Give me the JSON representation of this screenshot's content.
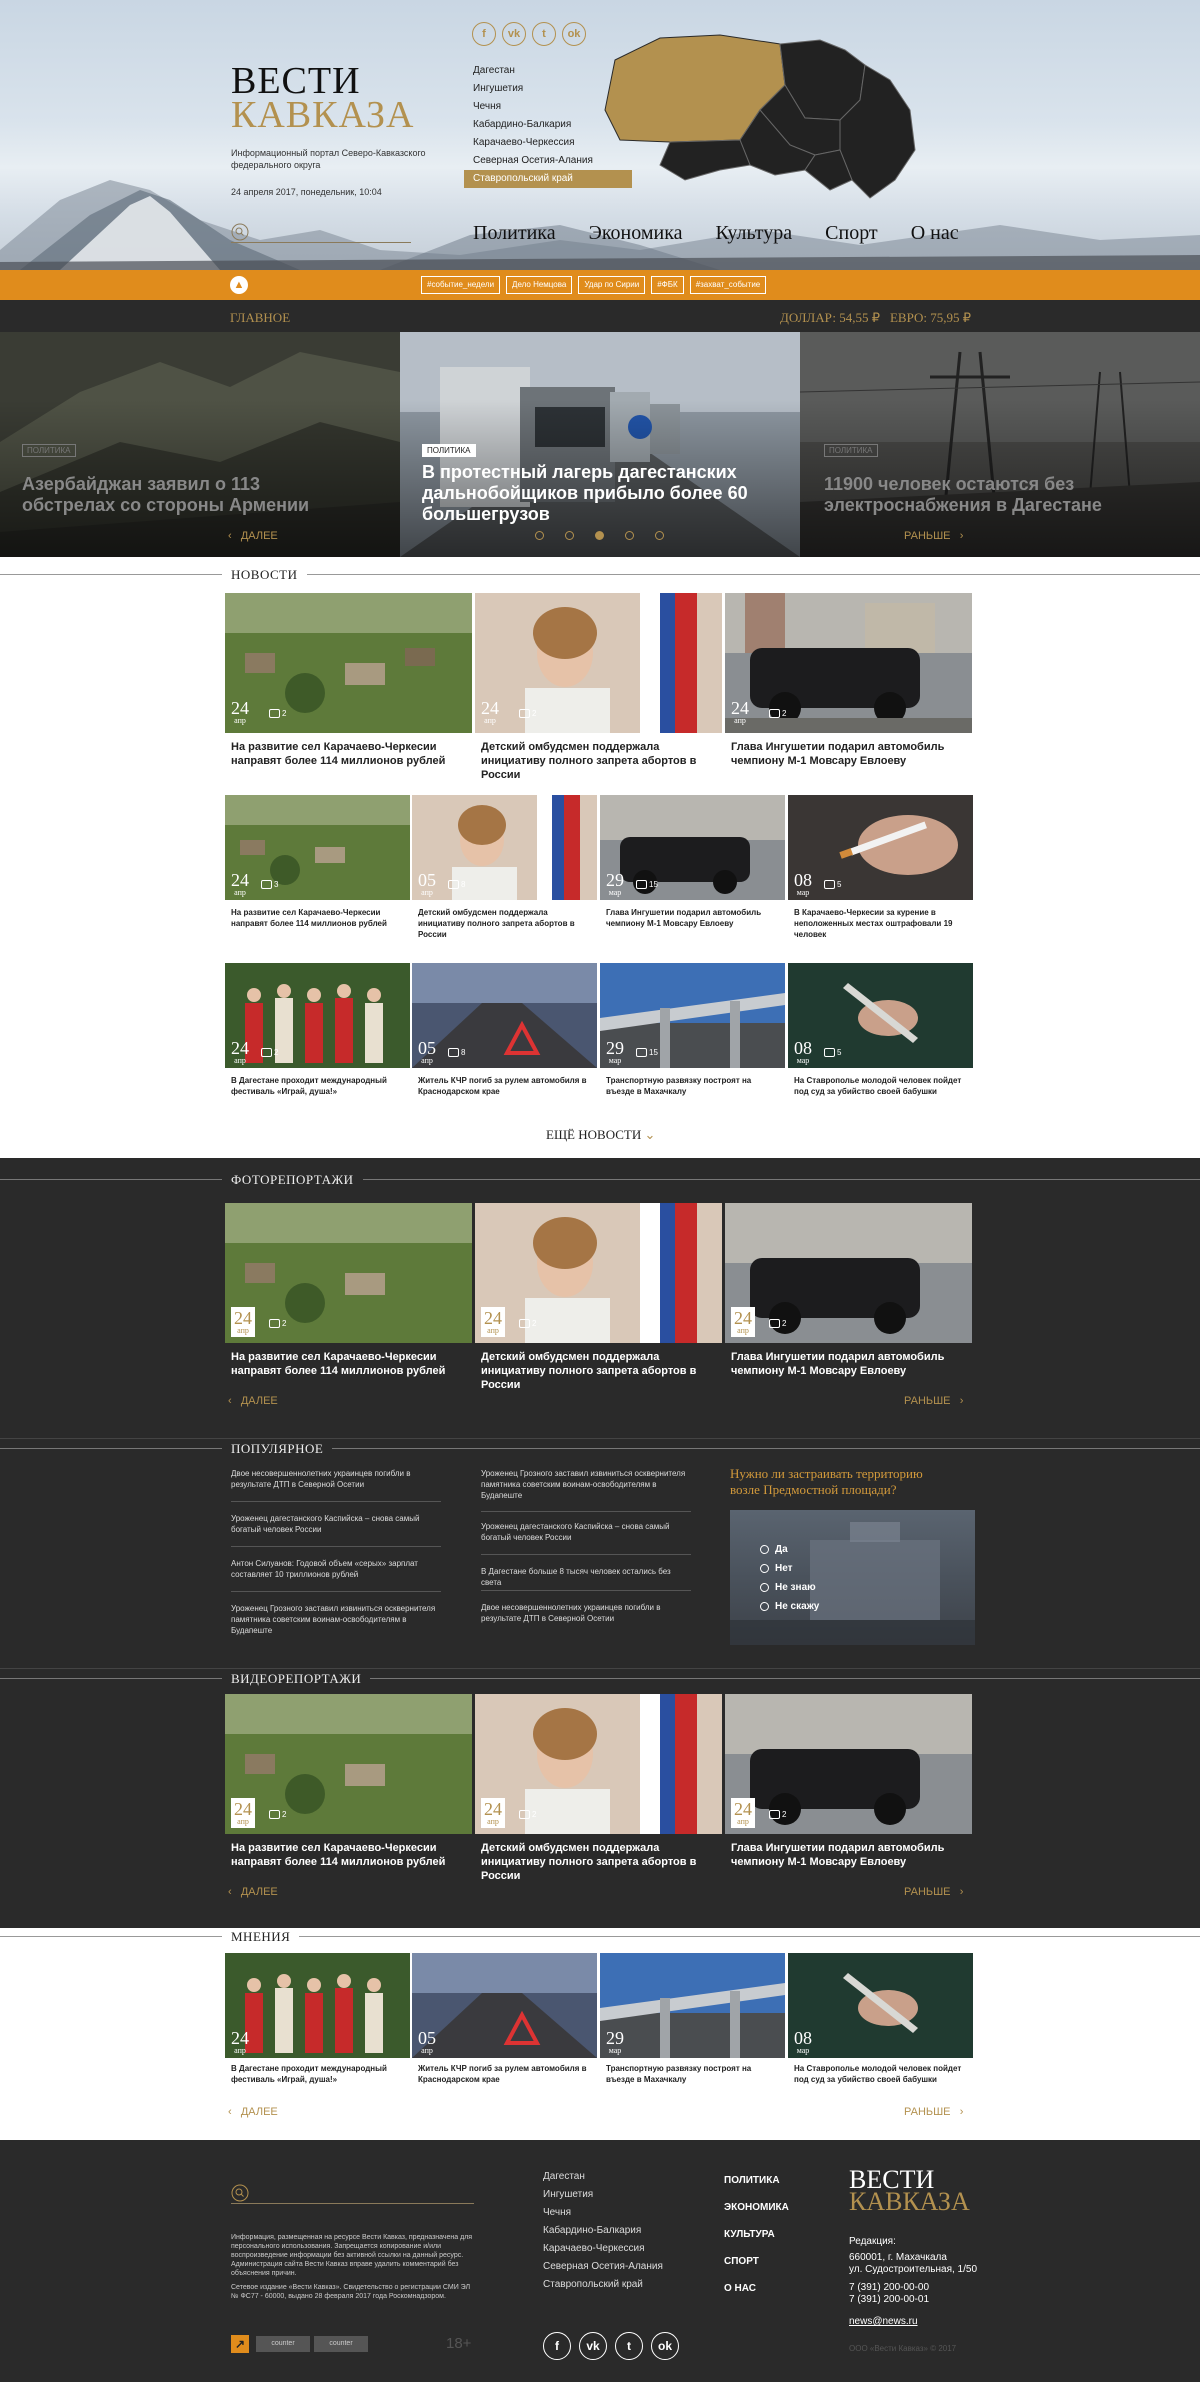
{
  "header": {
    "logo_line1": "ВЕСТИ",
    "logo_line2": "КАВКАЗА",
    "portal_desc": "Информационный портал Северо-Кавказского федерального округа",
    "date": "24 апреля 2017, понедельник, 10:04",
    "social_icons": [
      "facebook-icon",
      "vk-icon",
      "twitter-icon",
      "odnoklassniki-icon"
    ],
    "regions": [
      "Дагестан",
      "Ингушетия",
      "Чечня",
      "Кабардино-Балкария",
      "Карачаево-Черкессия",
      "Северная Осетия-Алания",
      "Ставропольский край"
    ],
    "active_region": "Ставропольский край",
    "nav": [
      "Политика",
      "Экономика",
      "Культура",
      "Спорт",
      "О нас"
    ]
  },
  "tagbar": {
    "tags": [
      "#событие_недели",
      "Дело Немцова",
      "Удар по Сирии",
      "#ФБК",
      "#захват_событие"
    ]
  },
  "topbar": {
    "label": "ГЛАВНОЕ",
    "dollar": "ДОЛЛАР: 54,55 ₽",
    "euro": "ЕВРО: 75,95 ₽"
  },
  "slider": {
    "slides": [
      {
        "label": "ПОЛИТИКА",
        "title": "Азербайджан заявил о 113 обстрелах со стороны Армении"
      },
      {
        "label": "ПОЛИТИКА",
        "title": "В протестный лагерь дагестанских дальнобойщиков прибыло более 60 большегрузов"
      },
      {
        "label": "ПОЛИТИКА",
        "title": "11900 человек остаются без электроснабжения в Дагестане"
      }
    ],
    "prev": "ДАЛЕЕ",
    "next": "РАНЬШЕ",
    "active_dot": 3
  },
  "news": {
    "heading": "НОВОСТИ",
    "big": [
      {
        "day": "24",
        "mon": "апр",
        "comments": "2",
        "title": "На развитие сел Карачаево-Черкесии направят более 114 миллионов рублей"
      },
      {
        "day": "24",
        "mon": "апр",
        "comments": "2",
        "title": "Детский омбудсмен поддержала инициативу полного запрета абортов в России"
      },
      {
        "day": "24",
        "mon": "апр",
        "comments": "2",
        "title": "Глава Ингушетии подарил автомобиль чемпиону М-1 Мовсару Евлоеву"
      }
    ],
    "row2": [
      {
        "day": "24",
        "mon": "апр",
        "comments": "3",
        "title": "На развитие сел Карачаево-Черкесии направят более 114 миллионов рублей"
      },
      {
        "day": "05",
        "mon": "апр",
        "comments": "8",
        "title": "Детский омбудсмен поддержала инициативу полного запрета абортов в России"
      },
      {
        "day": "29",
        "mon": "мар",
        "comments": "15",
        "title": "Глава Ингушетии подарил автомобиль чемпиону М-1 Мовсару Евлоеву"
      },
      {
        "day": "08",
        "mon": "мар",
        "comments": "5",
        "title": "В Карачаево-Черкесии за курение в неположенных местах оштрафовали 19 человек"
      }
    ],
    "row3": [
      {
        "day": "24",
        "mon": "апр",
        "comments": "2",
        "title": "В Дагестане проходит международный фестиваль «Играй, душа!»"
      },
      {
        "day": "05",
        "mon": "апр",
        "comments": "8",
        "title": "Житель КЧР погиб за рулем автомобиля в Краснодарском крае"
      },
      {
        "day": "29",
        "mon": "мар",
        "comments": "15",
        "title": "Транспортную развязку построят на въезде в Махачкалу"
      },
      {
        "day": "08",
        "mon": "мар",
        "comments": "5",
        "title": "На Ставрополье молодой человек пойдет под суд за убийство своей бабушки"
      }
    ],
    "more": "ЕЩЁ НОВОСТИ"
  },
  "photo": {
    "heading": "ФОТОРЕПОРТАЖИ",
    "items": [
      {
        "day": "24",
        "mon": "апр",
        "comments": "2",
        "title": "На развитие сел Карачаево-Черкесии направят более 114 миллионов рублей"
      },
      {
        "day": "24",
        "mon": "апр",
        "comments": "2",
        "title": "Детский омбудсмен поддержала инициативу полного запрета абортов в России"
      },
      {
        "day": "24",
        "mon": "апр",
        "comments": "2",
        "title": "Глава Ингушетии подарил автомобиль чемпиону М-1 Мовсару Евлоеву"
      }
    ],
    "prev": "ДАЛЕЕ",
    "next": "РАНЬШЕ"
  },
  "popular": {
    "heading": "ПОПУЛЯРНОЕ",
    "col1": [
      "Двое несовершеннолетних украинцев погибли в результате ДТП в Северной Осетии",
      "Уроженец дагестанского Каспийска – снова самый богатый человек России",
      "Антон Силуанов: Годовой объем «серых» зарплат составляет 10 триллионов рублей",
      "Уроженец Грозного заставил извиниться осквернителя памятника советским воинам-освободителям в Будапеште"
    ],
    "col2": [
      "Уроженец Грозного заставил извиниться осквернителя памятника советским воинам-освободителям в Будапеште",
      "Уроженец дагестанского Каспийска – снова самый богатый человек России",
      "В Дагестане больше 8 тысяч человек остались без света",
      "Двое несовершеннолетних украинцев погибли в результате ДТП в Северной Осетии"
    ],
    "poll_question": "Нужно ли застраивать территорию возле Предмостной площади?",
    "poll_options": [
      "Да",
      "Нет",
      "Не знаю",
      "Не скажу"
    ]
  },
  "video": {
    "heading": "ВИДЕОРЕПОРТАЖИ",
    "items": [
      {
        "day": "24",
        "mon": "апр",
        "comments": "2",
        "title": "На развитие сел Карачаево-Черкесии направят более 114 миллионов рублей"
      },
      {
        "day": "24",
        "mon": "апр",
        "comments": "2",
        "title": "Детский омбудсмен поддержала инициативу полного запрета абортов в России"
      },
      {
        "day": "24",
        "mon": "апр",
        "comments": "2",
        "title": "Глава Ингушетии подарил автомобиль чемпиону М-1 Мовсару Евлоеву"
      }
    ],
    "prev": "ДАЛЕЕ",
    "next": "РАНЬШЕ"
  },
  "opinions": {
    "heading": "МНЕНИЯ",
    "items": [
      {
        "day": "24",
        "mon": "апр",
        "title": "В Дагестане проходит международный фестиваль «Играй, душа!»"
      },
      {
        "day": "05",
        "mon": "апр",
        "title": "Житель КЧР погиб за рулем автомобиля в Краснодарском крае"
      },
      {
        "day": "29",
        "mon": "мар",
        "title": "Транспортную развязку построят на въезде в Махачкалу"
      },
      {
        "day": "08",
        "mon": "мар",
        "title": "На Ставрополье молодой человек пойдет под суд за убийство своей бабушки"
      }
    ],
    "prev": "ДАЛЕЕ",
    "next": "РАНЬШЕ"
  },
  "footer": {
    "disclaimer": "Информация, размещенная на ресурсе Вести Кавказ, предназначена для персонального использования. Запрещается копирование и/или воспроизведение информации без активной ссылки на данный ресурс. Администрация сайта Вести Кавказ вправе удалить комментарий без объяснения причин.",
    "registration": "Сетевое издание «Вести Кавказ». Свидетельство о регистрации СМИ ЭЛ № ФС77 - 60000, выдано 28 февраля 2017 года Роскомнадзором.",
    "counter1": "counter",
    "counter2": "counter",
    "age": "18+",
    "regions": [
      "Дагестан",
      "Ингушетия",
      "Чечня",
      "Кабардино-Балкария",
      "Карачаево-Черкессия",
      "Северная Осетия-Алания",
      "Ставропольский край"
    ],
    "nav": [
      "ПОЛИТИКА",
      "ЭКОНОМИКА",
      "КУЛЬТУРА",
      "СПОРТ",
      "О НАС"
    ],
    "logo_line1": "ВЕСТИ",
    "logo_line2": "КАВКАЗА",
    "editorial_label": "Редакция:",
    "address1": "660001, г. Махачкала",
    "address2": "ул. Судостроительная, 1/50",
    "phone1": "7 (391) 200-00-00",
    "phone2": "7 (391) 200-00-01",
    "email": "news@news.ru",
    "copyright": "ООО «Вести Кавказ» © 2017",
    "social_icons": [
      "facebook-icon",
      "vk-icon",
      "twitter-icon",
      "odnoklassniki-icon"
    ]
  },
  "colors": {
    "accent_gold": "#b3914f",
    "orange_bar": "#e08c1c",
    "dark_bg": "#2a2a2a"
  }
}
